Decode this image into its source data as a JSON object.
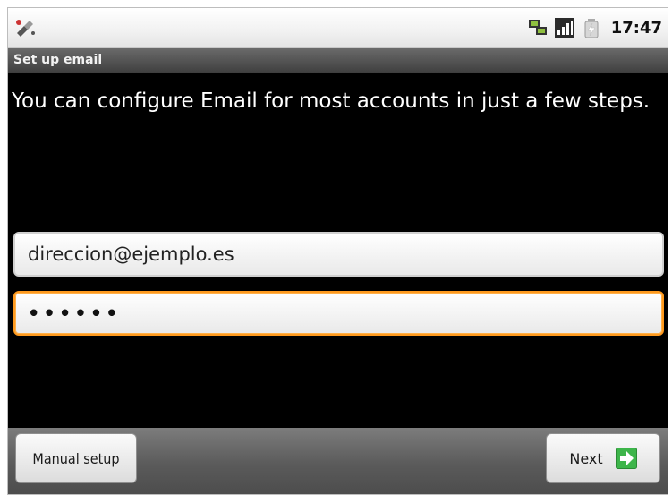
{
  "status_bar": {
    "time": "17:47",
    "icons": [
      "usb-debug-icon",
      "data-sync-icon",
      "signal-strength-icon",
      "battery-charging-icon"
    ]
  },
  "title_bar": {
    "title": "Set up email"
  },
  "main": {
    "instructions": "You can configure Email for most accounts in just a few steps.",
    "email_value": "direccion@ejemplo.es",
    "password_value": "••••••",
    "password_focus_color": "#ff9a1e"
  },
  "bottom_bar": {
    "manual_setup_label": "Manual setup",
    "next_label": "Next",
    "next_icon": "arrow-right-icon",
    "next_icon_color": "#3db54a"
  }
}
